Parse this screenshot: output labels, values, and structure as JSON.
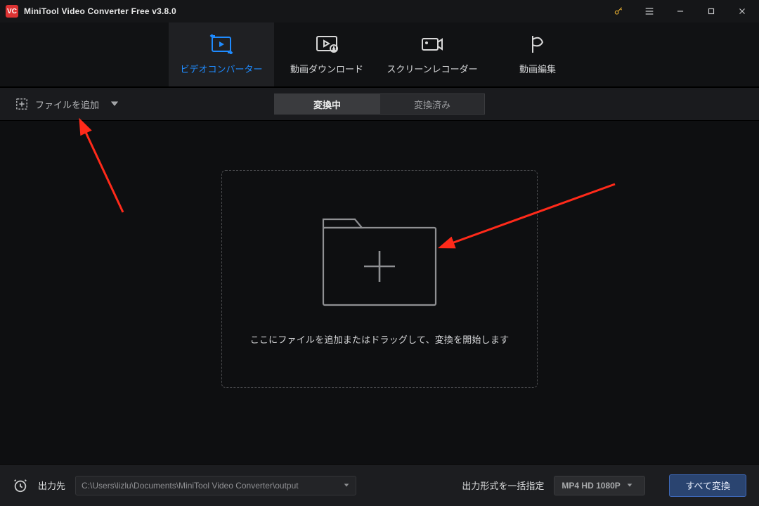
{
  "titlebar": {
    "app_title": "MiniTool Video Converter Free v3.8.0"
  },
  "main_tabs": {
    "converter": "ビデオコンバーター",
    "download": "動画ダウンロード",
    "recorder": "スクリーンレコーダー",
    "editor": "動画編集"
  },
  "toolbar": {
    "add_files": "ファイルを追加",
    "seg_converting": "変換中",
    "seg_converted": "変換済み"
  },
  "dropzone": {
    "hint": "ここにファイルを追加またはドラッグして、変換を開始します"
  },
  "bottom": {
    "output_label": "出力先",
    "output_path": "C:\\Users\\lizlu\\Documents\\MiniTool Video Converter\\output",
    "format_label": "出力形式を一括指定",
    "format_value": "MP4 HD 1080P",
    "convert_all": "すべて変換"
  },
  "colors": {
    "accent_blue": "#1f8bff",
    "annotation_red": "#ff2a1a"
  }
}
